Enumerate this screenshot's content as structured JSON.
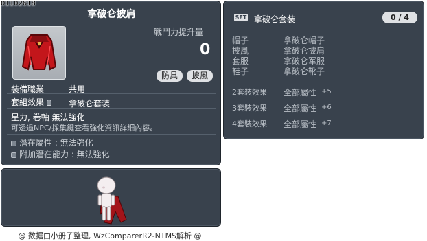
{
  "item": {
    "id": "01102618",
    "title": "拿破仑披肩",
    "power_label": "戰鬥力提升量",
    "power_value": "0",
    "tags": [
      "防具",
      "披風"
    ],
    "job_label": "裝備職業",
    "job_value": "共用",
    "set_label": "套組效果",
    "set_value": "拿破仑套装",
    "enhance_line": "星力, 卷軸 無法強化",
    "note": "可透過NPC/採集鍵查看強化資訊詳細內容。",
    "potential": "潛在屬性 : 無法強化",
    "bonus_potential": "附加潛在能力 : 無法強化"
  },
  "set": {
    "badge": "SET",
    "name": "拿破仑套装",
    "count": "0 / 4",
    "parts": [
      {
        "slot": "帽子",
        "name": "拿破仑帽子"
      },
      {
        "slot": "披風",
        "name": "拿破仑披肩"
      },
      {
        "slot": "套服",
        "name": "拿破仑军服"
      },
      {
        "slot": "鞋子",
        "name": "拿破仑靴子"
      }
    ],
    "effects": [
      {
        "label": "2套裝效果",
        "stat": "全部屬性",
        "value": "+5"
      },
      {
        "label": "3套裝效果",
        "stat": "全部屬性",
        "value": "+6"
      },
      {
        "label": "4套裝效果",
        "stat": "全部屬性",
        "value": "+7"
      }
    ]
  },
  "footer": "@ 数据由小册子整理, WzComparerR2-NTMS解析 @",
  "colors": {
    "panel_bg": "#39424d",
    "cape_red": "#c3161b",
    "text_main": "#ffffff",
    "text_muted": "#b9bfc6"
  }
}
